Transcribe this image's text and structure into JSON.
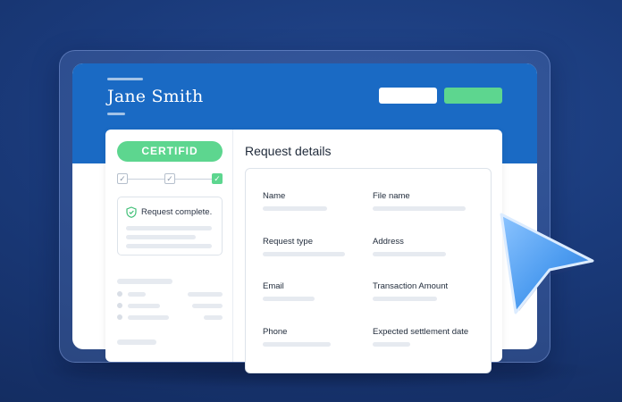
{
  "header": {
    "user_name": "Jane Smith"
  },
  "sidebar": {
    "badge_label": "CERTIFID",
    "steps": [
      {
        "icon": "check-icon",
        "state": "pending"
      },
      {
        "icon": "check-icon",
        "state": "pending"
      },
      {
        "icon": "check-icon",
        "state": "complete"
      }
    ],
    "status_text": "Request complete.",
    "status_icon": "shield-check-icon"
  },
  "main": {
    "title": "Request details",
    "fields": {
      "name": "Name",
      "file_name": "File name",
      "request_type": "Request type",
      "address": "Address",
      "email": "Email",
      "transaction_amount": "Transaction Amount",
      "phone": "Phone",
      "expected_settlement_date": "Expected settlement date"
    }
  },
  "colors": {
    "background": "#1a3a7a",
    "header_blue": "#1a6ac4",
    "accent_green": "#5dd68f",
    "cursor_blue": "#4d9cf0"
  }
}
